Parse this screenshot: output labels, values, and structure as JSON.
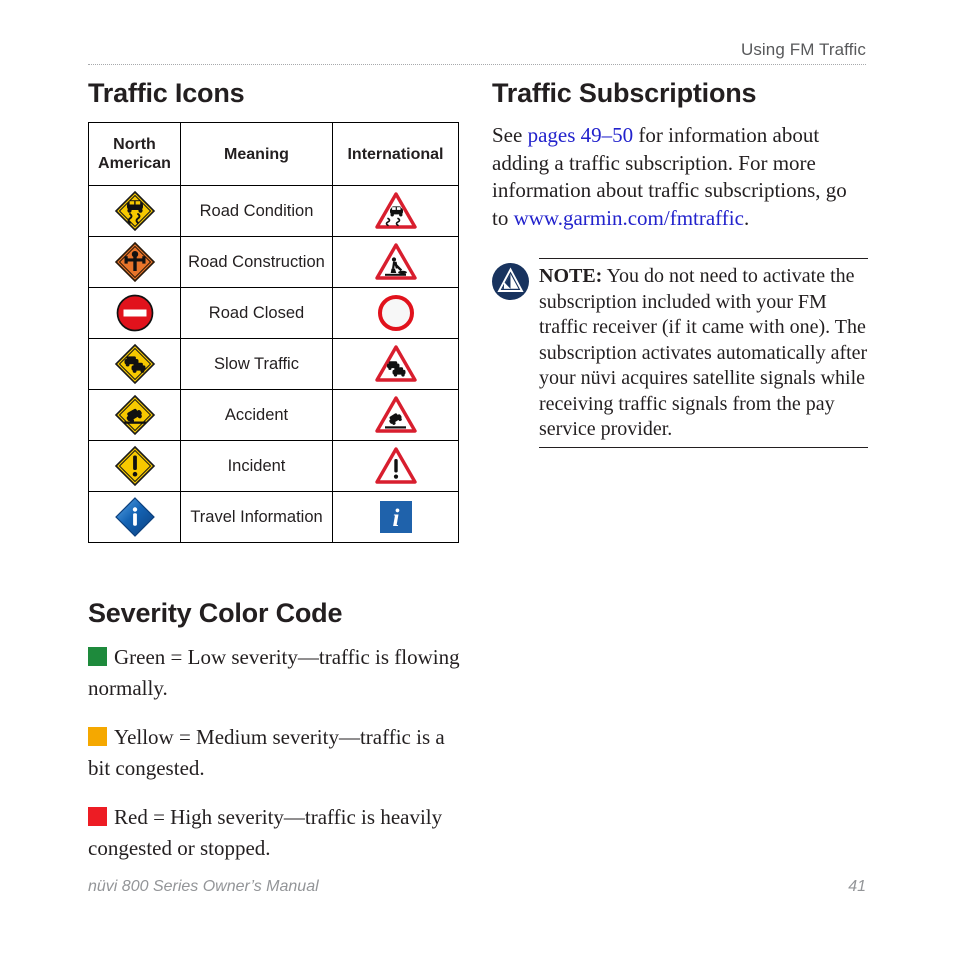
{
  "header": {
    "running_title": "Using FM Traffic"
  },
  "left_column": {
    "section_title": "Traffic Icons",
    "table": {
      "columns": [
        "North American",
        "Meaning",
        "International"
      ],
      "rows": [
        {
          "north_american_icon": "slippery-road-yellow-diamond-icon",
          "meaning": "Road Condition",
          "international_icon": "slippery-road-red-triangle-icon"
        },
        {
          "north_american_icon": "road-work-orange-diamond-icon",
          "meaning": "Road Construction",
          "international_icon": "road-work-red-triangle-icon"
        },
        {
          "north_american_icon": "do-not-enter-red-circle-icon",
          "meaning": "Road Closed",
          "international_icon": "road-closed-red-circle-icon"
        },
        {
          "north_american_icon": "slow-traffic-yellow-diamond-icon",
          "meaning": "Slow Traffic",
          "international_icon": "traffic-queue-red-triangle-icon"
        },
        {
          "north_american_icon": "accident-yellow-diamond-icon",
          "meaning": "Accident",
          "international_icon": "accident-red-triangle-icon"
        },
        {
          "north_american_icon": "incident-yellow-diamond-icon",
          "meaning": "Incident",
          "international_icon": "incident-red-triangle-icon"
        },
        {
          "north_american_icon": "travel-information-blue-diamond-icon",
          "meaning": "Travel Information",
          "international_icon": "travel-information-blue-square-icon"
        }
      ]
    }
  },
  "severity": {
    "section_title": "Severity Color Code",
    "items": [
      {
        "color": "#1e8a3c",
        "swatch_name": "green-severity-swatch",
        "text": "Green = Low severity—traffic is flowing normally."
      },
      {
        "color": "#f5a800",
        "swatch_name": "yellow-severity-swatch",
        "text": "Yellow = Medium severity—traffic is a bit congested."
      },
      {
        "color": "#ed1c24",
        "swatch_name": "red-severity-swatch",
        "text": "Red = High severity—traffic is heavily congested or stopped."
      }
    ]
  },
  "right_column": {
    "section_title": "Traffic Subscriptions",
    "paragraph": {
      "part1": "See ",
      "link1": "pages 49–50",
      "part2": " for information about adding a traffic subscription. For more information about traffic subscriptions, go to ",
      "link2": "www.garmin.com/fmtraffic",
      "part3": "."
    },
    "note": {
      "icon": "garmin-note-icon",
      "label": "NOTE:",
      "text": " You do not need to activate the subscription included with your FM traffic receiver (if it came with one). The subscription activates automatically after your nüvi acquires satellite signals while receiving traffic signals from the pay service provider."
    }
  },
  "footer": {
    "manual_title": "nüvi 800 Series Owner’s Manual",
    "page_number": "41"
  }
}
